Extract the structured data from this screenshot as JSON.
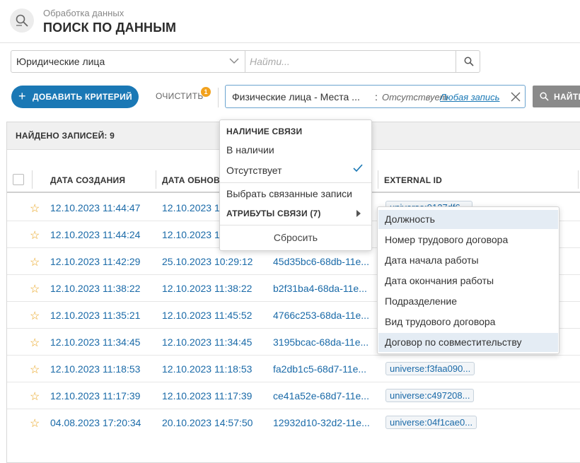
{
  "header": {
    "subtitle": "Обработка данных",
    "title": "ПОИСК ПО ДАННЫМ",
    "icon": "search-data-icon"
  },
  "searchbar": {
    "entity": "Юридические лица",
    "placeholder": "Найти..."
  },
  "toolbar": {
    "add_label": "ДОБАВИТЬ КРИТЕРИЙ",
    "clear_label": "ОЧИСТИТЬ",
    "clear_badge": "1",
    "find_label": "НАЙТИ"
  },
  "criterion": {
    "field": "Физические лица - Места ...",
    "colon": ":",
    "value": "Отсутствует",
    "link": "Любая запись"
  },
  "results": {
    "found_label": "НАЙДЕНО ЗАПИСЕЙ: 9",
    "columns": [
      "ДАТА СОЗДАНИЯ",
      "ДАТА ОБНОВЛ",
      "EXTERNAL ID"
    ],
    "rows": [
      {
        "created": "12.10.2023 11:44:47",
        "updated": "12.10.2023 1",
        "id": "",
        "ext": "universe:9127df6..."
      },
      {
        "created": "12.10.2023 11:44:24",
        "updated": "12.10.2023 1",
        "id": "",
        "ext": ""
      },
      {
        "created": "12.10.2023 11:42:29",
        "updated": "25.10.2023 10:29:12",
        "id": "45d35bc6-68db-11e...",
        "ext": ""
      },
      {
        "created": "12.10.2023 11:38:22",
        "updated": "12.10.2023 11:38:22",
        "id": "b2f31ba4-68da-11e...",
        "ext": ""
      },
      {
        "created": "12.10.2023 11:35:21",
        "updated": "12.10.2023 11:45:52",
        "id": "4766c253-68da-11e...",
        "ext": ""
      },
      {
        "created": "12.10.2023 11:34:45",
        "updated": "12.10.2023 11:34:45",
        "id": "3195bcac-68da-11e...",
        "ext": ""
      },
      {
        "created": "12.10.2023 11:18:53",
        "updated": "12.10.2023 11:18:53",
        "id": "fa2db1c5-68d7-11e...",
        "ext": "universe:f3faa090..."
      },
      {
        "created": "12.10.2023 11:17:39",
        "updated": "12.10.2023 11:17:39",
        "id": "ce41a52e-68d7-11e...",
        "ext": "universe:c497208..."
      },
      {
        "created": "04.08.2023 17:20:34",
        "updated": "20.10.2023 14:57:50",
        "id": "12932d10-32d2-11e...",
        "ext": "universe:04f1cae0..."
      }
    ]
  },
  "menu": {
    "section": "НАЛИЧИЕ СВЯЗИ",
    "present": "В наличии",
    "absent": "Отсутствует",
    "select_related": "Выбрать связанные записи",
    "attributes": "АТРИБУТЫ СВЯЗИ (7)",
    "reset": "Сбросить"
  },
  "submenu": {
    "items": [
      "Должность",
      "Номер трудового договора",
      "Дата начала работы",
      "Дата окончания работы",
      "Подразделение",
      "Вид трудового договора",
      "Договор по совместительству"
    ]
  },
  "colors": {
    "accent": "#1a78b5",
    "badge": "#f2a21e",
    "star": "#e8a21a",
    "find_button": "#8a8a8a"
  }
}
